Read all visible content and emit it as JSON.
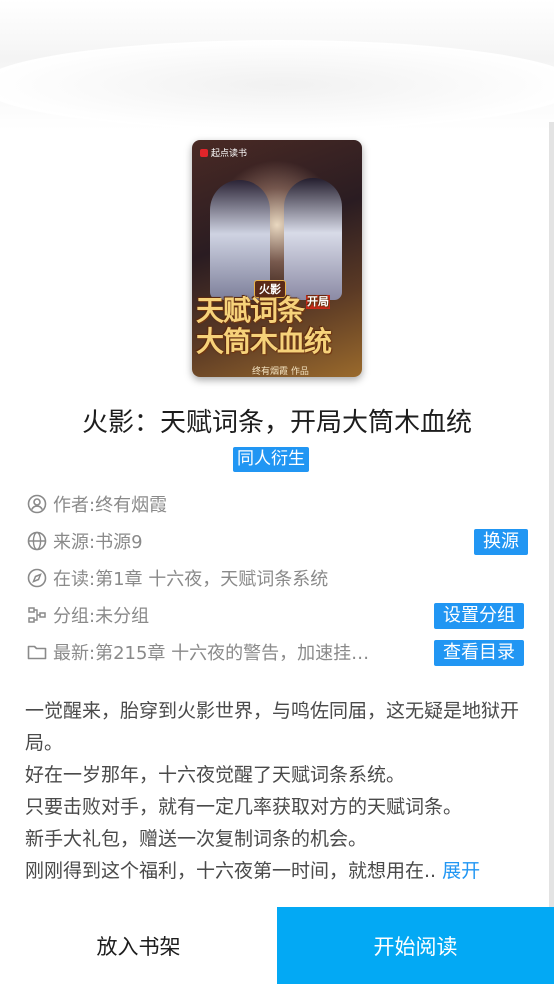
{
  "book": {
    "title": "火影：天赋词条，开局大筒木血统",
    "genre": "同人衍生",
    "cover": {
      "brand": "起点读书",
      "subtitle": "火影",
      "title_line1": "天赋词条",
      "title_tag": "开局",
      "title_line2": "大筒木血统",
      "author": "终有烟霞 作品"
    }
  },
  "info": {
    "author": {
      "label": "作者:",
      "value": "终有烟霞"
    },
    "source": {
      "label": "来源:",
      "value": "书源9",
      "action": "换源"
    },
    "reading": {
      "label": "在读:",
      "value": "第1章 十六夜，天赋词条系统"
    },
    "group": {
      "label": "分组:",
      "value": "未分组",
      "action": "设置分组"
    },
    "latest": {
      "label": "最新:",
      "value": "第215章 十六夜的警告，加速挂…",
      "action": "查看目录"
    }
  },
  "intro": {
    "lines": [
      "一觉醒来，胎穿到火影世界，与鸣佐同届，这无疑是地狱开局。",
      "好在一岁那年，十六夜觉醒了天赋词条系统。",
      "只要击败对手，就有一定几率获取对方的天赋词条。",
      "新手大礼包，赠送一次复制词条的机会。",
      "刚刚得到这个福利，十六夜第一时间，就想用在.."
    ],
    "expand": "展开"
  },
  "actions": {
    "add_to_shelf": "放入书架",
    "start_reading": "开始阅读"
  },
  "colors": {
    "accent": "#2196f3",
    "read_button": "#03a9f4"
  }
}
